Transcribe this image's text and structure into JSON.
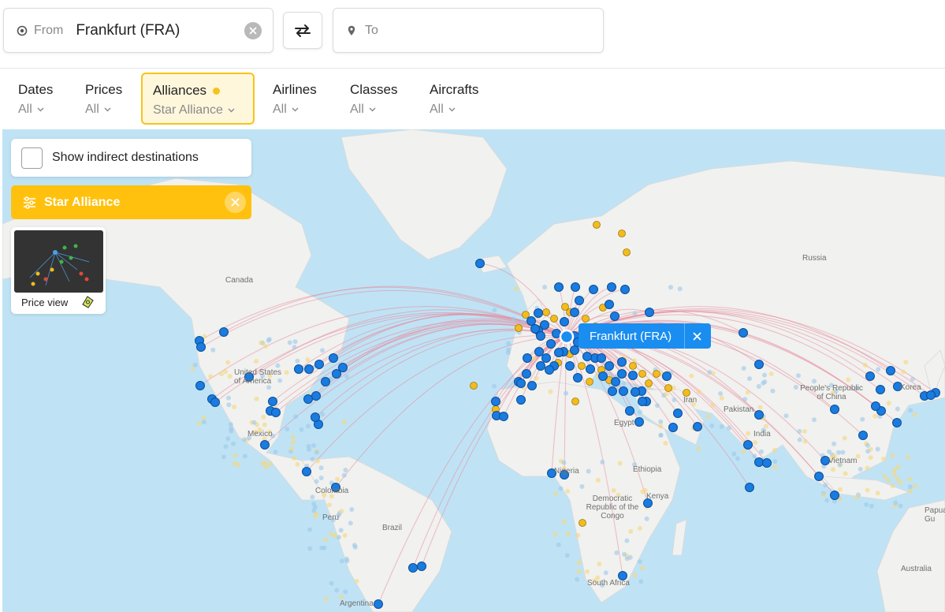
{
  "search": {
    "from_label": "From",
    "from_value": "Frankfurt (FRA)",
    "to_placeholder": "To"
  },
  "filters": [
    {
      "label": "Dates",
      "value": "All",
      "active": false
    },
    {
      "label": "Prices",
      "value": "All",
      "active": false
    },
    {
      "label": "Alliances",
      "value": "Star Alliance",
      "active": true
    },
    {
      "label": "Airlines",
      "value": "All",
      "active": false
    },
    {
      "label": "Classes",
      "value": "All",
      "active": false
    },
    {
      "label": "Aircrafts",
      "value": "All",
      "active": false
    }
  ],
  "map_panel": {
    "indirect_label": "Show indirect destinations",
    "alliance_chip": "Star Alliance",
    "price_view_label": "Price view",
    "origin_tag": "Frankfurt (FRA)"
  },
  "map_labels": {
    "canada": "Canada",
    "usa": "United States of America",
    "mexico": "Mexico",
    "colombia": "Colombia",
    "peru": "Peru",
    "brazil": "Brazil",
    "argentina": "Argentina",
    "russia": "Russia",
    "iran": "Iran",
    "pakistan": "Pakistan",
    "india": "India",
    "china": "People's Republic of China",
    "korea": "Korea",
    "vietnam": "Vietnam",
    "egypt": "Egypt",
    "nigeria": "Nigeria",
    "ethiopia": "Ethiopia",
    "kenya": "Kenya",
    "drc": "Democratic Republic of the Congo",
    "south_africa": "South Africa",
    "australia": "Australia",
    "papua": "Papua Gu"
  },
  "colors": {
    "accent": "#ffc10e",
    "direct_dot": "#1a7be0",
    "partner_dot": "#f4bb1c",
    "route_line": "#e58a9c",
    "water": "#bfe3f5",
    "land": "#f1f1ef"
  },
  "icons": {
    "origin": "target-icon",
    "destination": "pin-icon",
    "swap": "swap-arrows-icon",
    "clear": "close-icon",
    "filter": "sliders-icon",
    "price": "money-icon"
  }
}
